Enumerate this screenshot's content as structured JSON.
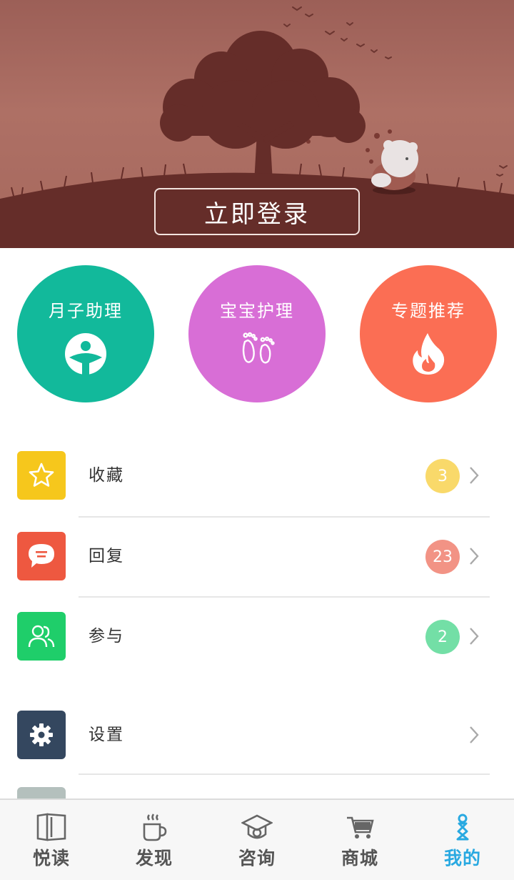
{
  "header": {
    "login_label": "立即登录"
  },
  "shortcuts": [
    {
      "label": "月子助理",
      "icon": "mother-care-icon",
      "color": "#12b99b"
    },
    {
      "label": "宝宝护理",
      "icon": "baby-footprints-icon",
      "color": "#d86ed6"
    },
    {
      "label": "专题推荐",
      "icon": "flame-icon",
      "color": "#fb6e54"
    }
  ],
  "menu": [
    {
      "label": "收藏",
      "icon": "star-icon",
      "icon_color": "#f6c71c",
      "badge": "3",
      "badge_color": "#f9d96a"
    },
    {
      "label": "回复",
      "icon": "chat-bubble-icon",
      "icon_color": "#ee5840",
      "badge": "23",
      "badge_color": "#f29385"
    },
    {
      "label": "参与",
      "icon": "people-icon",
      "icon_color": "#1fce6a",
      "badge": "2",
      "badge_color": "#73dfa6"
    },
    {
      "label": "设置",
      "icon": "gear-icon",
      "icon_color": "#34475f",
      "badge": "",
      "badge_color": ""
    }
  ],
  "tabbar": [
    {
      "label": "悦读",
      "icon": "book-icon",
      "active": false
    },
    {
      "label": "发现",
      "icon": "coffee-cup-icon",
      "active": false
    },
    {
      "label": "咨询",
      "icon": "graduation-cap-icon",
      "active": false
    },
    {
      "label": "商城",
      "icon": "shopping-cart-icon",
      "active": false
    },
    {
      "label": "我的",
      "icon": "person-icon",
      "active": true
    }
  ],
  "colors": {
    "accent": "#29a9e1",
    "banner_dark": "#652d29"
  }
}
